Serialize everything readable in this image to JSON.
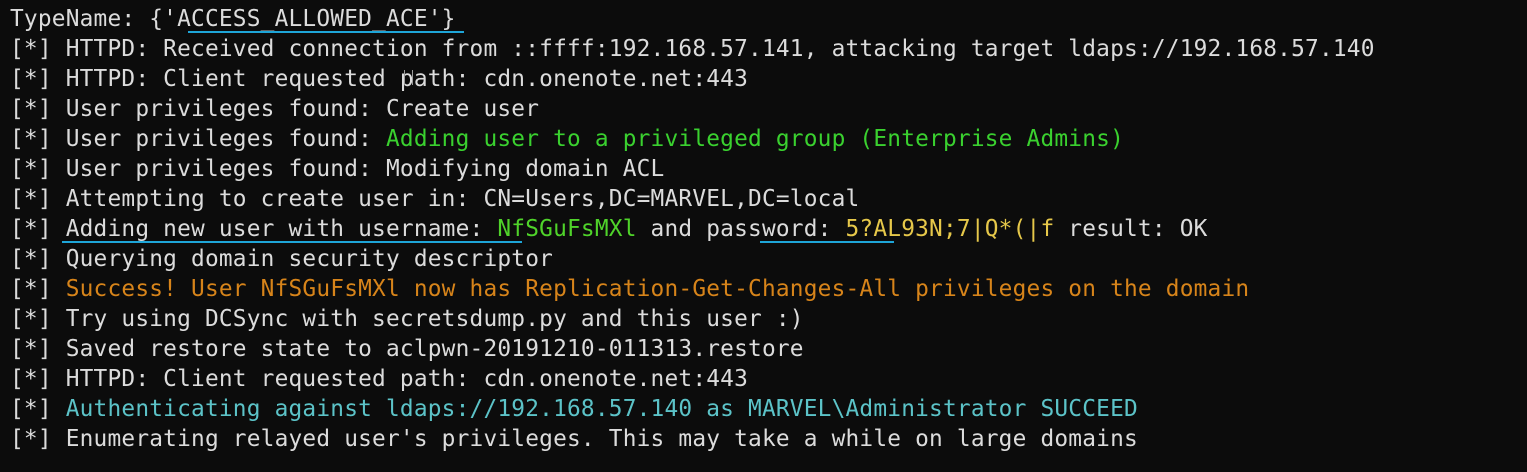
{
  "terminal": {
    "lines": [
      [
        {
          "text": "TypeName: {'ACCESS_ALLOWED_ACE'}",
          "color": "default"
        }
      ],
      [
        {
          "text": "[*] HTTPD: Received connection from ::ffff:192.168.57.141, attacking target ldaps://192.168.57.140",
          "color": "default"
        }
      ],
      [
        {
          "text": "[*] HTTPD: Client requested path: cdn.onenote.net:443",
          "color": "default"
        }
      ],
      [
        {
          "text": "[*] User privileges found: Create user",
          "color": "default"
        }
      ],
      [
        {
          "text": "[*] User privileges found: ",
          "color": "default"
        },
        {
          "text": "Adding user to a privileged group (Enterprise Admins)",
          "color": "green"
        }
      ],
      [
        {
          "text": "[*] User privileges found: Modifying domain ACL",
          "color": "default"
        }
      ],
      [
        {
          "text": "[*] Attempting to create user in: CN=Users,DC=MARVEL,DC=local",
          "color": "default"
        }
      ],
      [
        {
          "text": "[*] Adding new user with username: ",
          "color": "default"
        },
        {
          "text": "NfSGuFsMXl",
          "color": "lime"
        },
        {
          "text": " and password: ",
          "color": "default"
        },
        {
          "text": "5?AL93N;7|Q*(|f",
          "color": "yellow"
        },
        {
          "text": " result: OK",
          "color": "default"
        }
      ],
      [
        {
          "text": "[*] Querying domain security descriptor",
          "color": "default"
        }
      ],
      [
        {
          "text": "[*] ",
          "color": "default"
        },
        {
          "text": "Success! User NfSGuFsMXl now has Replication-Get-Changes-All privileges on the domain",
          "color": "orange"
        }
      ],
      [
        {
          "text": "[*] Try using DCSync with secretsdump.py and this user :)",
          "color": "default"
        }
      ],
      [
        {
          "text": "[*] Saved restore state to aclpwn-20191210-011313.restore",
          "color": "default"
        }
      ],
      [
        {
          "text": "[*] HTTPD: Client requested path: cdn.onenote.net:443",
          "color": "default"
        }
      ],
      [
        {
          "text": "[*] ",
          "color": "default"
        },
        {
          "text": "Authenticating against ldaps://192.168.57.140 as MARVEL\\Administrator SUCCEED",
          "color": "cyan"
        }
      ],
      [
        {
          "text": "[*] Enumerating relayed user's privileges. This may take a while on large domains",
          "color": "default"
        }
      ]
    ],
    "highlight_color": "#1ea5d8"
  }
}
